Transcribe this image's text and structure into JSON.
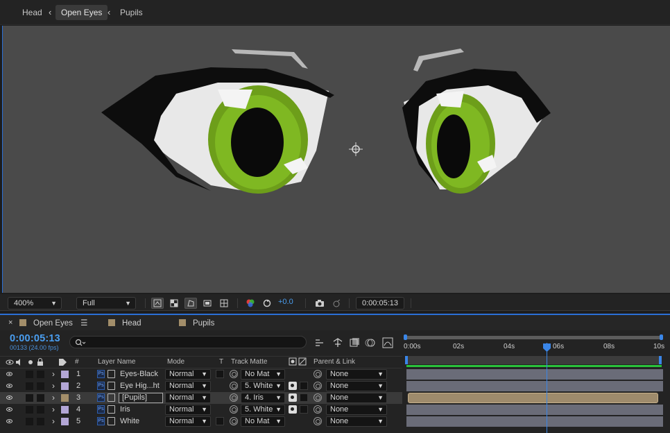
{
  "breadcrumbs": [
    {
      "label": "Head",
      "active": false
    },
    {
      "label": "Open Eyes",
      "active": true
    },
    {
      "label": "Pupils",
      "active": false
    }
  ],
  "viewer_toolbar": {
    "zoom": "400%",
    "resolution": "Full",
    "exposure": "+0.0",
    "current_time": "0:00:05:13"
  },
  "timeline": {
    "tabs": [
      "Open Eyes",
      "Head",
      "Pupils"
    ],
    "time_code": "0:00:05:13",
    "frame_info": "00133 (24.00 fps)",
    "search_placeholder": "",
    "headers": {
      "number": "#",
      "layer_name": "Layer Name",
      "mode": "Mode",
      "t": "T",
      "track_matte": "Track Matte",
      "parent": "Parent & Link"
    },
    "ruler_ticks": [
      "0:00s",
      "02s",
      "04s",
      "06s",
      "08s",
      "10s"
    ],
    "layers": [
      {
        "num": "1",
        "name": "Eyes-Black",
        "mode": "Normal",
        "matte": "No Mat",
        "parent": "None",
        "color": "#b3a6d6",
        "selected": false,
        "has_matte_icon": false
      },
      {
        "num": "2",
        "name": "Eye Hig...ht",
        "mode": "Normal",
        "matte": "5. White",
        "parent": "None",
        "color": "#b3a6d6",
        "selected": false,
        "has_matte_icon": true
      },
      {
        "num": "3",
        "name": "[Pupils]",
        "mode": "Normal",
        "matte": "4. Iris",
        "parent": "None",
        "color": "#a38e6a",
        "selected": true,
        "has_matte_icon": true
      },
      {
        "num": "4",
        "name": "Iris",
        "mode": "Normal",
        "matte": "5. White",
        "parent": "None",
        "color": "#b3a6d6",
        "selected": false,
        "has_matte_icon": true
      },
      {
        "num": "5",
        "name": "White",
        "mode": "Normal",
        "matte": "No Mat",
        "parent": "None",
        "color": "#b3a6d6",
        "selected": false,
        "has_matte_icon": false
      }
    ]
  }
}
